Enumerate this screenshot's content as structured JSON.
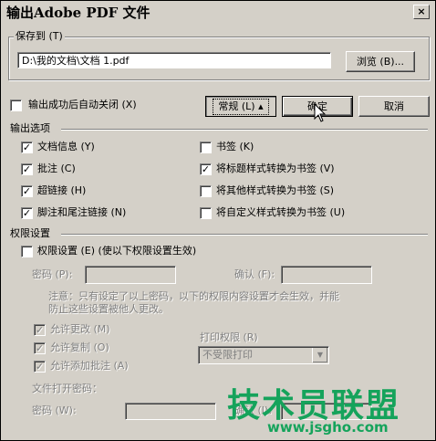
{
  "window": {
    "title": "输出Adobe PDF 文件",
    "close_glyph": "×"
  },
  "save_group": {
    "label": "保存到 (T)",
    "path_value": "D:\\我的文档\\文档 1.pdf",
    "browse_label": "浏览 (B)..."
  },
  "auto_close": {
    "label": "输出成功后自动关闭 (X)",
    "checked": false
  },
  "buttons": {
    "general": "常规 (L) ▴",
    "ok": "确定",
    "cancel": "取消"
  },
  "output_options": {
    "title": "输出选项",
    "left": [
      {
        "label": "文档信息 (Y)",
        "checked": true
      },
      {
        "label": "批注 (C)",
        "checked": true
      },
      {
        "label": "超链接 (H)",
        "checked": true
      },
      {
        "label": "脚注和尾注链接 (N)",
        "checked": true
      }
    ],
    "right": [
      {
        "label": "书签 (K)",
        "checked": false
      },
      {
        "label": "将标题样式转换为书签 (V)",
        "checked": true
      },
      {
        "label": "将其他样式转换为书签 (S)",
        "checked": false
      },
      {
        "label": "将自定义样式转换为书签 (U)",
        "checked": false
      }
    ]
  },
  "permissions": {
    "title": "权限设置",
    "enable_label": "权限设置 (E) (使以下权限设置生效)",
    "password_label": "密码 (P):",
    "confirm_label": "确认 (F):",
    "note_line1": "注意：只有设定了以上密码，以下的权限内容设置才会生效，并能",
    "note_line2": "防止这些设置被他人更改。",
    "allow_change": "允许更改 (M)",
    "allow_copy": "允许复制 (O)",
    "allow_annot": "允许添加批注 (A)",
    "print_label": "打印权限 (R)",
    "print_value": "不受限打印",
    "open_password_title": "文件打开密码：",
    "open_password_label": "密码 (W):",
    "open_confirm_label": "确认 (I):"
  },
  "watermark": {
    "big": "技术员联盟",
    "small": "www.jsgho.com"
  }
}
